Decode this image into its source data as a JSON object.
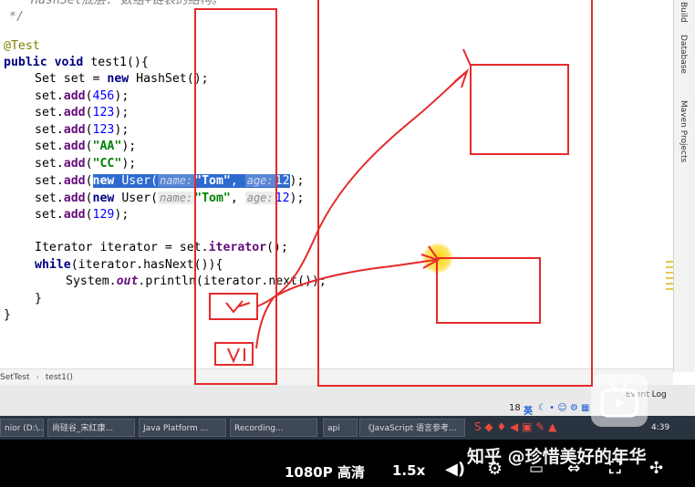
{
  "editor": {
    "lines": {
      "top_comment": "HashSet底层: 数组+链表的结构。",
      "comment_end": "*/",
      "annotation": "@Test",
      "sig_kw": "public void",
      "sig_name": " test1(){",
      "l_set_kw1": "Set set = ",
      "l_set_new": "new",
      "l_set_rest": " HashSet();",
      "add_prefix": "set.",
      "add_method": "add",
      "v456": "456",
      "v123a": "123",
      "v123b": "123",
      "vAA": "\"AA\"",
      "vCC": "\"CC\"",
      "user_new": "new",
      "user_ctor": " User(",
      "hint_name": "name:",
      "str_tom": "\"Tom\"",
      "hint_age": "age:",
      "v12": "12",
      "v129": "129",
      "iter_decl": "Iterator iterator = set.",
      "iter_method": "iterator",
      "iter_end": "();",
      "while_kw": "while",
      "while_rest": "(iterator.hasNext()){",
      "print_a": "System.",
      "print_out": "out",
      "print_b": ".println(iterator.next());",
      "brace_inner": "}",
      "brace_outer": "}"
    },
    "sidebar": {
      "build": "Build",
      "database": "Database",
      "maven": "Maven Projects"
    }
  },
  "breadcrumb": {
    "class": "SetTest",
    "method": "test1()"
  },
  "statusbar": {
    "event_log": "Event Log",
    "time": "4:39",
    "ime": "英",
    "num": "18"
  },
  "taskbar": {
    "items": [
      "nior (D:\\...",
      "尚硅谷_宋红康...",
      "Java Platform ...",
      "Recording...",
      "api",
      "《JavaScript 语言参考..."
    ]
  },
  "player": {
    "quality": "1080P 高清",
    "speed": "1.5x"
  },
  "watermark": "知乎 @珍惜美好的年华",
  "colors": {
    "annotation_red": "#e52b2b",
    "selection": "#2d6ad0",
    "cursor": "#ffd400"
  }
}
